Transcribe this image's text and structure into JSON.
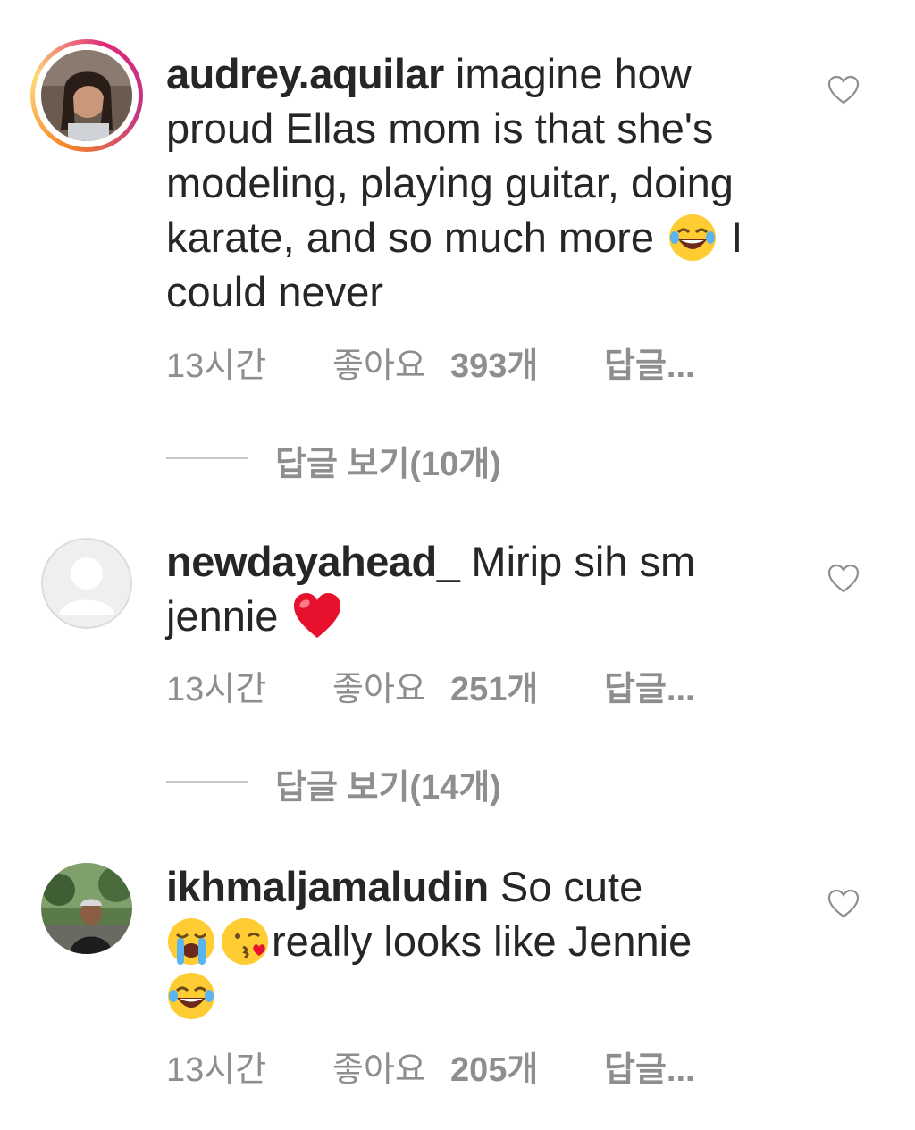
{
  "comments": [
    {
      "username": "audrey.aquilar",
      "text_pre": " imagine how proud Ellas mom is that she's modeling, playing guitar, doing karate, and so much more ",
      "emoji_names": [
        "joy-emoji"
      ],
      "text_post": " I could never",
      "time": "13시간",
      "likes_prefix": "좋아요",
      "likes_count": "393개",
      "reply_label": "답글...",
      "view_replies": "답글 보기(10개)",
      "avatar": "story-ring-photo"
    },
    {
      "username": "newdayahead_",
      "text_pre": " Mirip sih sm jennie ",
      "emoji_names": [
        "red-heart-emoji"
      ],
      "text_post": "",
      "time": "13시간",
      "likes_prefix": "좋아요",
      "likes_count": "251개",
      "reply_label": "답글...",
      "view_replies": "답글 보기(14개)",
      "avatar": "default-placeholder"
    },
    {
      "username": "ikhmaljamaludin",
      "text_pre": " So cute ",
      "emoji_names": [
        "loudly-crying-emoji",
        "kissing-heart-emoji"
      ],
      "text_mid": "really looks like Jennie ",
      "emoji_names_2": [
        "joy-emoji"
      ],
      "time": "13시간",
      "likes_prefix": "좋아요",
      "likes_count": "205개",
      "reply_label": "답글...",
      "avatar": "photo"
    }
  ],
  "icons": {
    "like": "heart-outline-icon"
  },
  "colors": {
    "text": "#262626",
    "secondary": "#8e8e8e",
    "divider": "#c7c7c7",
    "ring_start": "#f58529",
    "ring_end": "#dd2a7b"
  }
}
